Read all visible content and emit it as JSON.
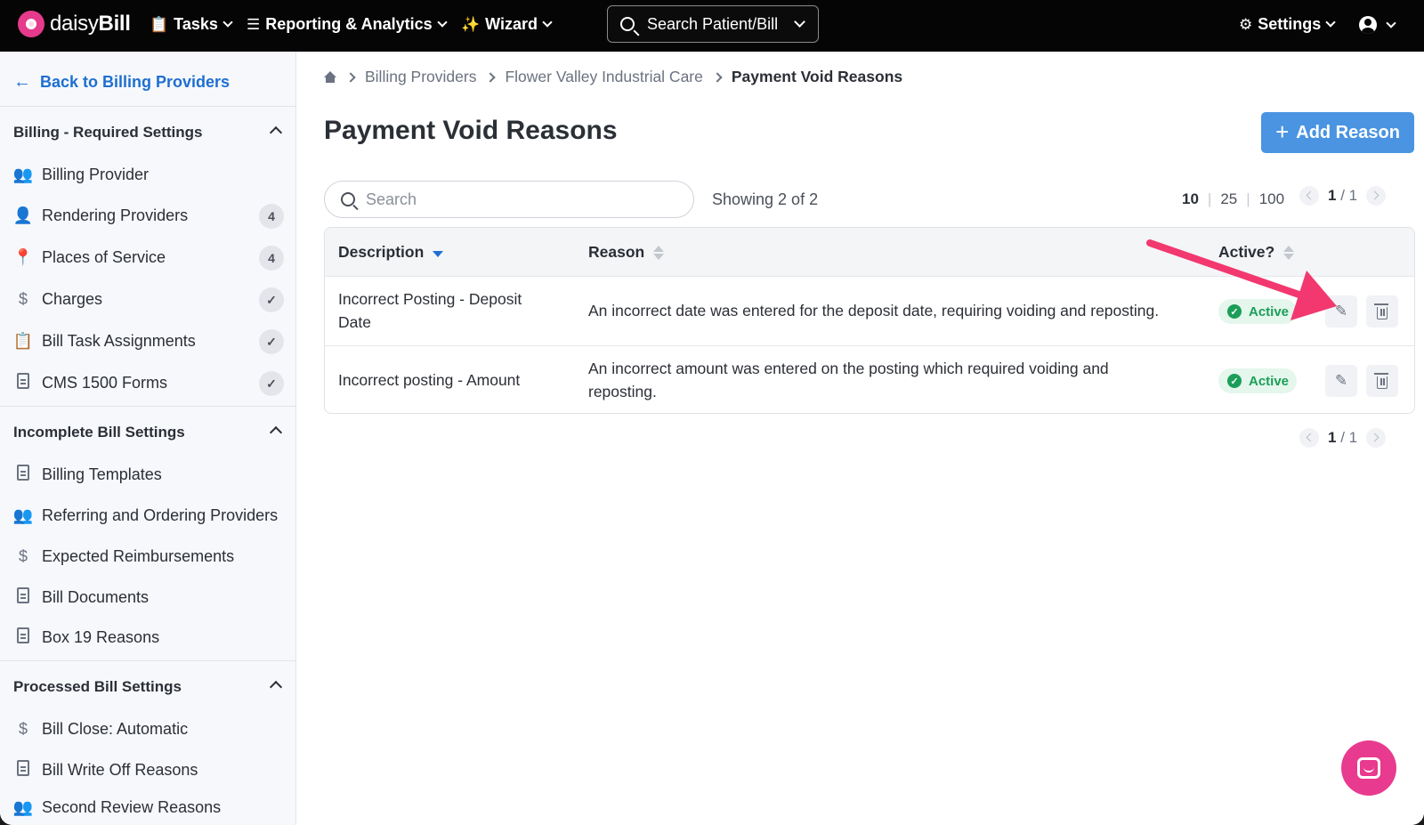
{
  "topnav": {
    "brand": {
      "name_light": "daisy",
      "name_bold": "Bill"
    },
    "items": [
      {
        "label": "Tasks",
        "icon": "clipboard-icon"
      },
      {
        "label": "Reporting & Analytics",
        "icon": "chart-icon"
      },
      {
        "label": "Wizard",
        "icon": "magic-wand-icon"
      }
    ],
    "search_label": "Search Patient/Bill",
    "settings_label": "Settings"
  },
  "sidebar": {
    "back_label": "Back to Billing Providers",
    "sections": [
      {
        "title": "Billing - Required Settings",
        "items": [
          {
            "label": "Billing Provider",
            "icon": "users-icon",
            "badge": ""
          },
          {
            "label": "Rendering Providers",
            "icon": "user-chat-icon",
            "badge": "4"
          },
          {
            "label": "Places of Service",
            "icon": "map-pin-icon",
            "badge": "4"
          },
          {
            "label": "Charges",
            "icon": "dollar-icon",
            "badge": "✓"
          },
          {
            "label": "Bill Task Assignments",
            "icon": "clipboard-check-icon",
            "badge": "✓"
          },
          {
            "label": "CMS 1500 Forms",
            "icon": "document-icon",
            "badge": "✓"
          }
        ]
      },
      {
        "title": "Incomplete Bill Settings",
        "items": [
          {
            "label": "Billing Templates",
            "icon": "document-icon"
          },
          {
            "label": "Referring and Ordering Providers",
            "icon": "users-icon"
          },
          {
            "label": "Expected Reimbursements",
            "icon": "dollar-icon"
          },
          {
            "label": "Bill Documents",
            "icon": "document-icon"
          },
          {
            "label": "Box 19 Reasons",
            "icon": "document-icon"
          }
        ]
      },
      {
        "title": "Processed Bill Settings",
        "items": [
          {
            "label": "Bill Close: Automatic",
            "icon": "dollar-icon"
          },
          {
            "label": "Bill Write Off Reasons",
            "icon": "document-icon"
          },
          {
            "label": "Second Review Reasons",
            "icon": "users-icon"
          }
        ]
      }
    ]
  },
  "main": {
    "breadcrumbs": [
      "Billing Providers",
      "Flower Valley Industrial Care",
      "Payment Void Reasons"
    ],
    "title": "Payment Void Reasons",
    "add_button": "Add Reason",
    "search_placeholder": "Search",
    "showing": "Showing 2 of 2",
    "per_page": [
      "10",
      "25",
      "100"
    ],
    "page_current": "1",
    "page_total": "/ 1",
    "columns": [
      "Description",
      "Reason",
      "Active?"
    ],
    "rows": [
      {
        "description": "Incorrect Posting - Deposit Date",
        "reason": "An incorrect date was entered for the deposit date, requiring voiding and reposting.",
        "status": "Active"
      },
      {
        "description": "Incorrect posting - Amount",
        "reason": "An incorrect amount was entered on the posting which required voiding and reposting.",
        "status": "Active"
      }
    ]
  },
  "colors": {
    "accent": "#1e6fd0",
    "button": "#4a94e2",
    "active": "#1b9e58",
    "annotation_arrow": "#f2386f",
    "chat": "#e83a8f"
  }
}
